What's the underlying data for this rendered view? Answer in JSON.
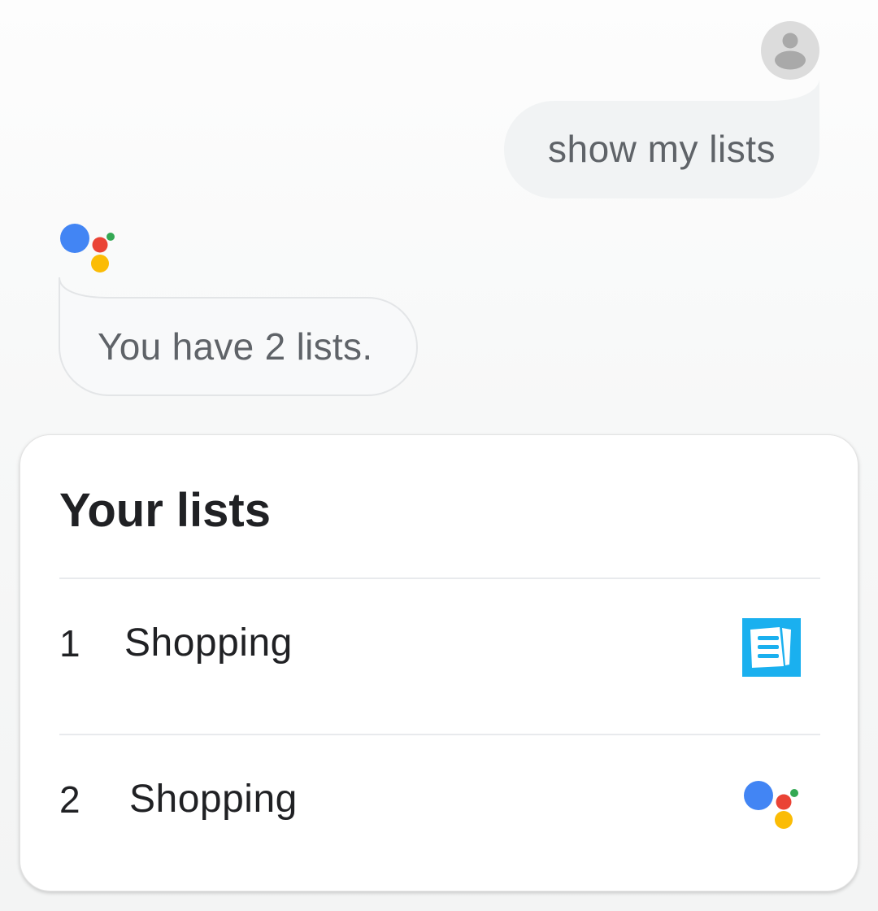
{
  "conversation": {
    "user_query": "show my lists",
    "assistant_reply": "You have 2 lists."
  },
  "icons": {
    "user": "user-avatar-icon",
    "assistant": "google-assistant-icon",
    "list_app": "list-app-icon"
  },
  "colors": {
    "assistant_blue": "#4285f4",
    "assistant_red": "#ea4335",
    "assistant_yellow": "#fbbc05",
    "assistant_green": "#34a853",
    "list_app_blue": "#1ab0ef"
  },
  "lists_card": {
    "title": "Your lists",
    "items": [
      {
        "number": "1",
        "name": "Shopping",
        "source_icon": "list-app-icon"
      },
      {
        "number": "2",
        "name": "Shopping",
        "source_icon": "google-assistant-icon"
      }
    ]
  }
}
